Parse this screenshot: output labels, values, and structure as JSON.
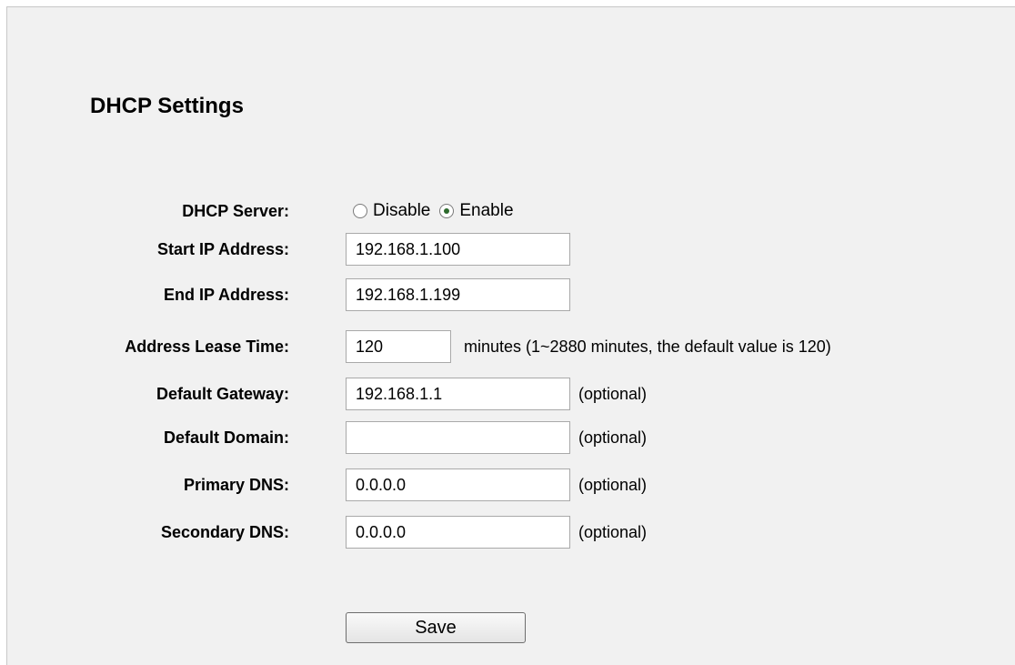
{
  "page": {
    "title": "DHCP Settings"
  },
  "dhcp_server": {
    "label": "DHCP Server:",
    "options": [
      {
        "label": "Disable",
        "checked": false
      },
      {
        "label": "Enable",
        "checked": true
      }
    ]
  },
  "start_ip": {
    "label": "Start IP Address:",
    "value": "192.168.1.100"
  },
  "end_ip": {
    "label": "End IP Address:",
    "value": "192.168.1.199"
  },
  "lease_time": {
    "label": "Address Lease Time:",
    "value": "120",
    "hint": "minutes (1~2880 minutes, the default value is 120)"
  },
  "gateway": {
    "label": "Default Gateway:",
    "value": "192.168.1.1",
    "hint": "(optional)"
  },
  "domain": {
    "label": "Default Domain:",
    "value": "",
    "hint": "(optional)"
  },
  "primary_dns": {
    "label": "Primary DNS:",
    "value": "0.0.0.0",
    "hint": "(optional)"
  },
  "secondary_dns": {
    "label": "Secondary DNS:",
    "value": "0.0.0.0",
    "hint": "(optional)"
  },
  "actions": {
    "save_label": "Save"
  }
}
